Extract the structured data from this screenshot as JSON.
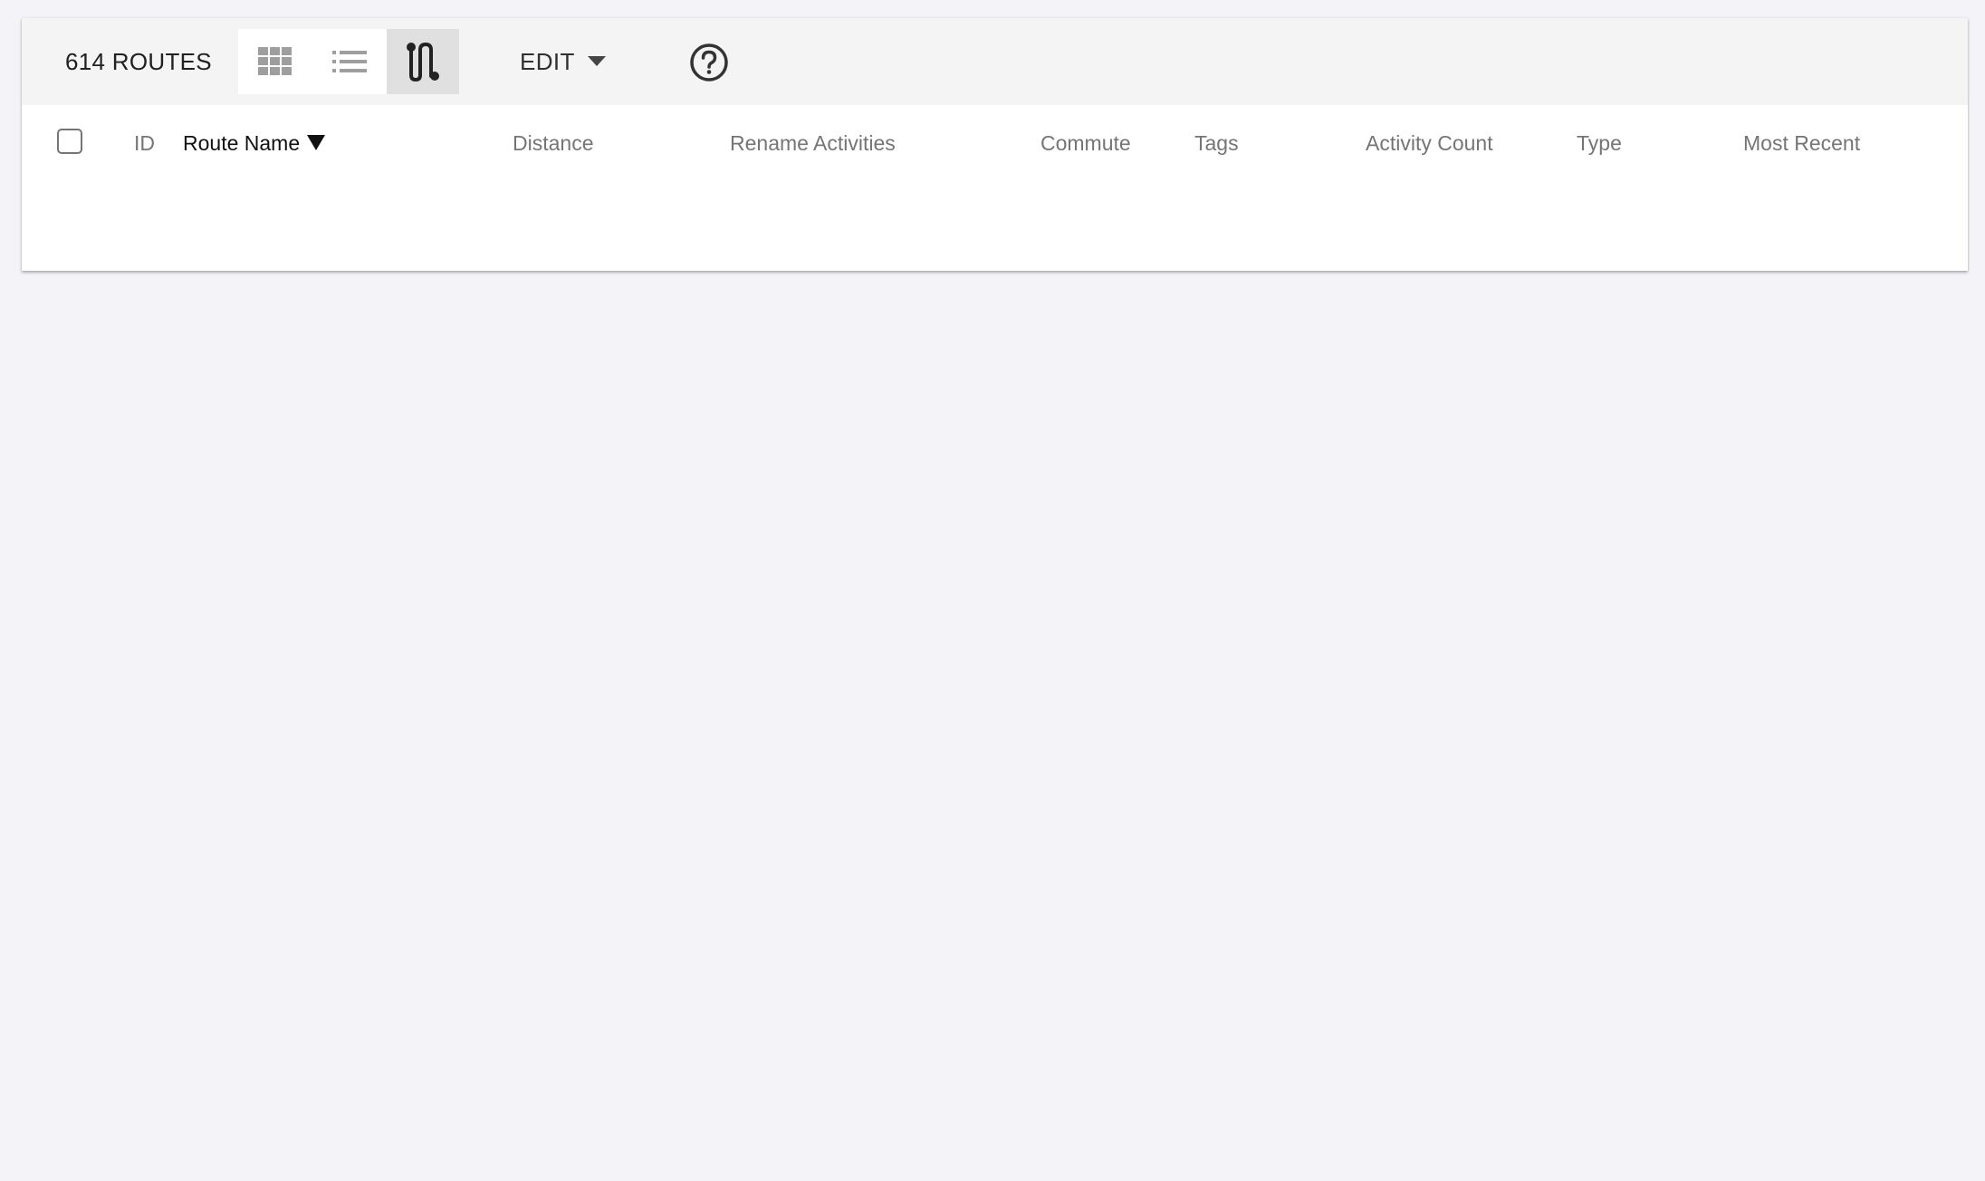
{
  "toolbar": {
    "route_count": "614 ROUTES",
    "view_toggle": {
      "options": [
        {
          "name": "grid",
          "icon": "grid-icon",
          "selected": false
        },
        {
          "name": "list",
          "icon": "list-icon",
          "selected": false
        },
        {
          "name": "routes",
          "icon": "route-icon",
          "selected": true
        }
      ]
    },
    "edit_label": "EDIT",
    "edit_icon": "caret-down-icon",
    "help_icon": "help-circle-icon"
  },
  "table": {
    "select_all_checked": false,
    "sort_column": "Route Name",
    "sort_direction": "descending",
    "sort_icon": "sort-down-icon",
    "columns": [
      {
        "label": "ID"
      },
      {
        "label": "Route Name"
      },
      {
        "label": "Distance"
      },
      {
        "label": "Rename Activities"
      },
      {
        "label": "Commute"
      },
      {
        "label": "Tags"
      },
      {
        "label": "Activity Count"
      },
      {
        "label": "Type"
      },
      {
        "label": "Most Recent"
      }
    ],
    "rows": []
  },
  "colors": {
    "page_background": "#f3f3f8",
    "toolbar_background": "#f4f4f4",
    "card_background": "#ffffff",
    "selected_toggle": "#e0e0e0",
    "header_text": "#757575",
    "sorted_header_text": "#111111"
  }
}
